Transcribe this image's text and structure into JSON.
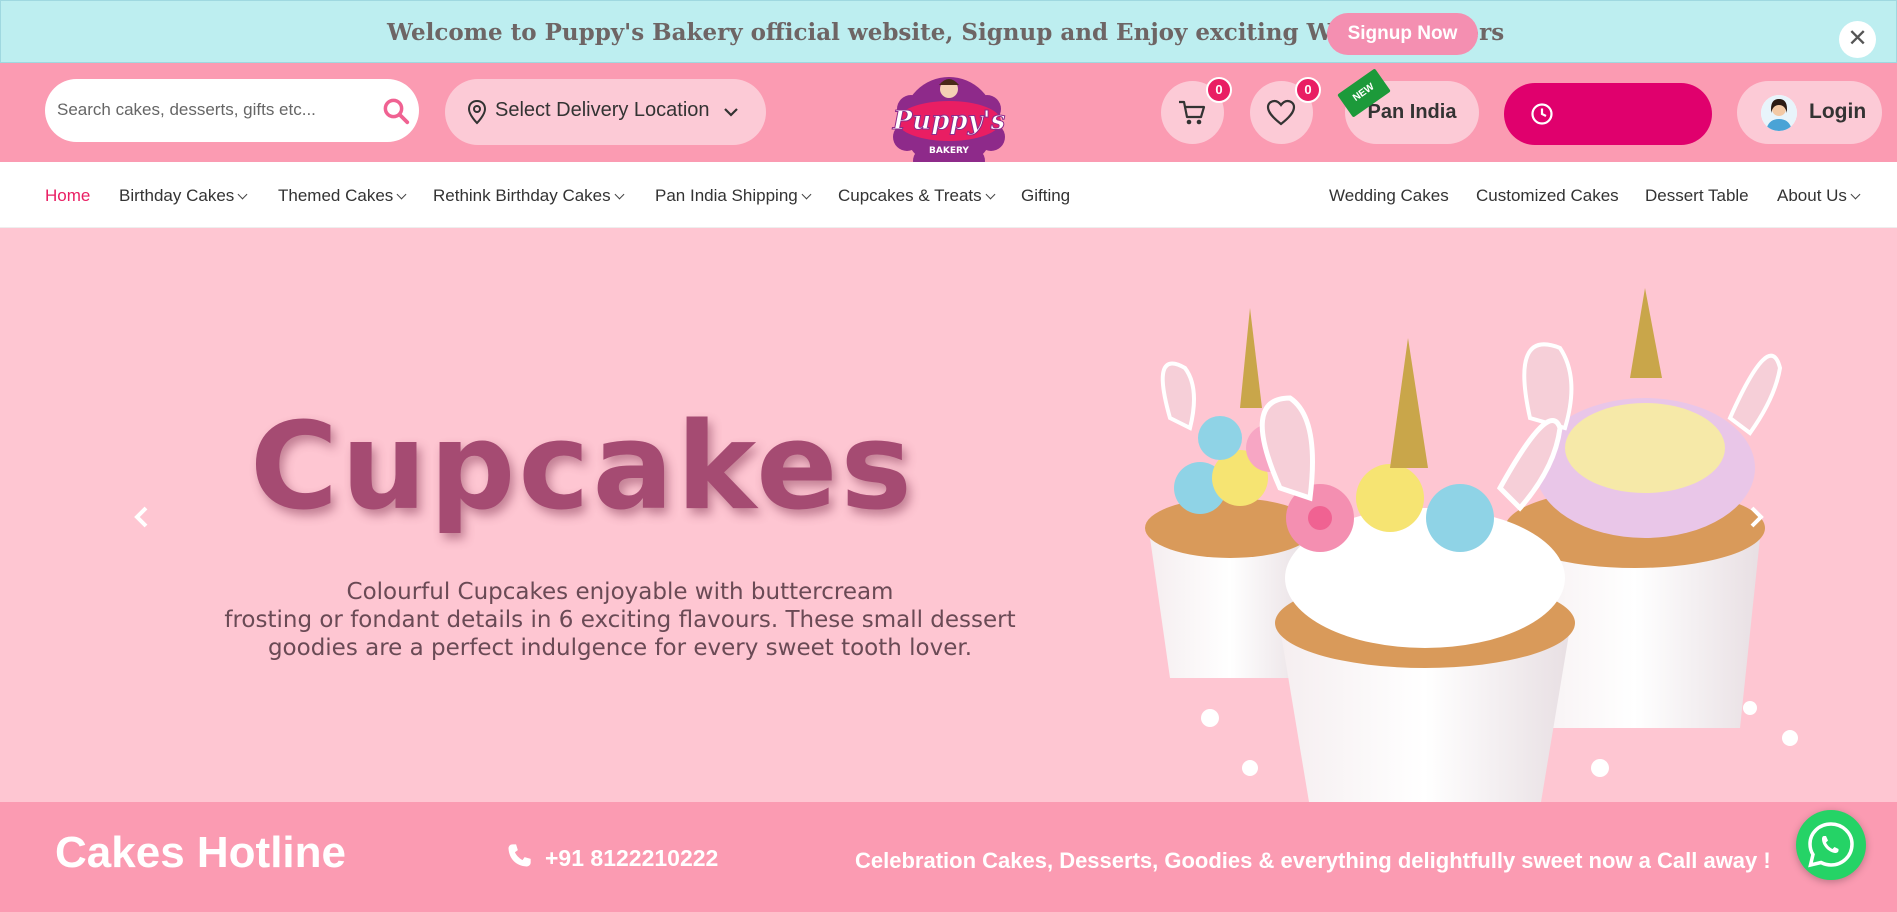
{
  "announcement": {
    "message": "Welcome to Puppy's Bakery official website, Signup and Enjoy exciting Welcome offers",
    "signup_label": "Signup Now",
    "close_glyph": "✕"
  },
  "header": {
    "search_placeholder": "Search cakes, desserts, gifts etc...",
    "location_label": "Select Delivery Location",
    "cart_count": "0",
    "wishlist_count": "0",
    "new_tag": "NEW",
    "pan_india_label": "Pan India",
    "login_label": "Login"
  },
  "nav": {
    "items": [
      {
        "label": "Home"
      },
      {
        "label": "Birthday Cakes"
      },
      {
        "label": "Themed Cakes"
      },
      {
        "label": "Rethink Birthday Cakes"
      },
      {
        "label": "Pan India Shipping"
      },
      {
        "label": "Cupcakes & Treats"
      },
      {
        "label": "Gifting"
      },
      {
        "label": "Wedding Cakes"
      },
      {
        "label": "Customized Cakes"
      },
      {
        "label": "Dessert Table"
      },
      {
        "label": "About Us"
      }
    ]
  },
  "hero": {
    "headline": "Cupcakes",
    "desc_line1": "Colourful Cupcakes enjoyable with buttercream",
    "desc_line2": "frosting or fondant details in 6 exciting flavours. These small dessert",
    "desc_line3": "goodies are a perfect indulgence for every sweet tooth lover."
  },
  "hotline": {
    "title": "Cakes Hotline",
    "number": "+91 8122210222",
    "tagline": "Celebration Cakes, Desserts, Goodies & everything delightfully sweet now a Call away !"
  },
  "colors": {
    "announce_bg": "#bdeef0",
    "header_pink": "#fb9bb2",
    "accent": "#e91e63",
    "hero_bg": "#fec6d2",
    "whatsapp": "#25d366"
  },
  "icons": [
    "search-icon",
    "location-pin-icon",
    "chevron-down-icon",
    "cart-icon",
    "heart-icon",
    "clock-icon",
    "avatar",
    "phone-icon",
    "whatsapp-icon",
    "close-icon",
    "arrow-left-icon",
    "arrow-right-icon"
  ]
}
